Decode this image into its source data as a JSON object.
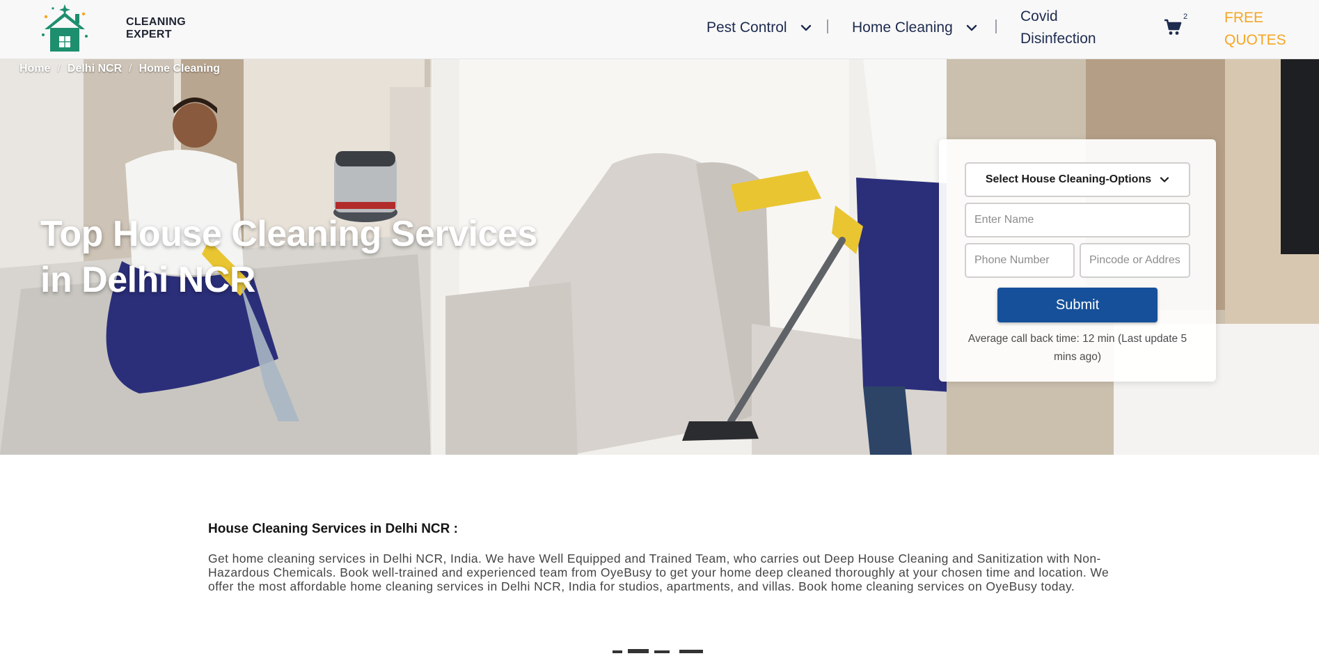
{
  "brand": {
    "name": "CLEANING EXPERT",
    "line1": "CLEANING",
    "line2": "EXPERT",
    "accent": "#1e8f6e"
  },
  "nav": {
    "items": [
      {
        "label": "Pest Control",
        "has_dropdown": true
      },
      {
        "label": "Home Cleaning",
        "has_dropdown": true
      },
      {
        "label": "Covid Disinfection",
        "line1": "Covid",
        "line2": "Disinfection",
        "has_dropdown": false
      }
    ],
    "cart_count": "2",
    "cta_line1": "FREE",
    "cta_line2": "QUOTES",
    "cta_color": "#f5a623",
    "text_color": "#1d2b4f"
  },
  "breadcrumb": [
    "Home",
    "Delhi NCR",
    "Home Cleaning"
  ],
  "hero": {
    "title_line1": "Top House Cleaning Services",
    "title_line2": "in Delhi NCR"
  },
  "form": {
    "select_label": "Select House Cleaning-Options",
    "name_placeholder": "Enter Name",
    "phone_placeholder": "Phone Number",
    "address_placeholder": "Pincode or Address",
    "submit_label": "Submit",
    "submit_color": "#16509a",
    "callback_text": "Average call back time: 12 min (Last update 5 mins ago)"
  },
  "content": {
    "title": "House Cleaning Services in Delhi NCR :",
    "body": "Get home cleaning services in Delhi NCR, India. We have Well Equipped and Trained Team, who carries out Deep House Cleaning and Sanitization with Non-Hazardous Chemicals. Book well-trained and experienced team from OyeBusy to get your home deep cleaned thoroughly at your chosen time and location. We offer the most affordable home cleaning services in Delhi NCR, India for studios, apartments, and villas. Book home cleaning services on OyeBusy today."
  },
  "icons": [
    "house-logo-icon",
    "chevron-down-icon",
    "cart-icon"
  ]
}
